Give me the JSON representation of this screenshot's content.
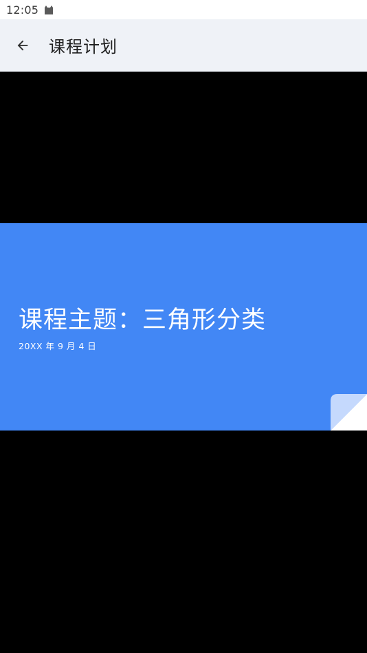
{
  "status_bar": {
    "time": "12:05",
    "notification_icon": "cat-icon"
  },
  "app_bar": {
    "back_icon": "arrow-left-icon",
    "title": "课程计划"
  },
  "slide": {
    "title": "课程主题：三角形分类",
    "date": "20XX 年 9 月 4 日",
    "background_color": "#4287f5",
    "curl_color": "#c5d9fd"
  }
}
